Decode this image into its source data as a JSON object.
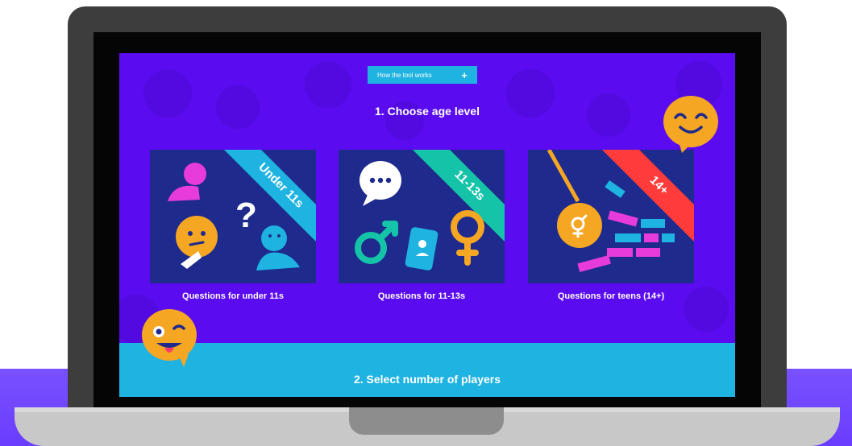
{
  "page": {
    "how_button": {
      "label": "How the tool works",
      "icon": "plus-icon"
    },
    "step1_title": "1. Choose age level",
    "step2_title": "2. Select number of players",
    "cards": [
      {
        "ribbon": "Under 11s",
        "caption": "Questions for under 11s",
        "ribbon_color": "#1eb3e1"
      },
      {
        "ribbon": "11-13s",
        "caption": "Questions for 11-13s",
        "ribbon_color": "#14c3a8"
      },
      {
        "ribbon": "14+",
        "caption": "Questions for teens (14+)",
        "ribbon_color": "#ff3b3b"
      }
    ]
  },
  "colors": {
    "screen_bg": "#5a0bf0",
    "card_bg": "#1e2a8c",
    "accent_blue": "#1eb3e1",
    "floor": "#6a3dff",
    "emoji": "#f5a623"
  }
}
